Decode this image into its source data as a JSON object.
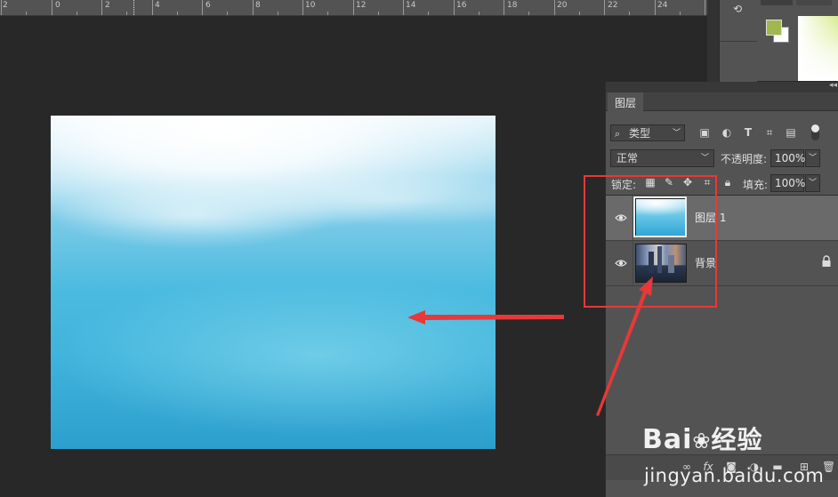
{
  "ruler": {
    "labels": [
      "2",
      "0",
      "2",
      "4",
      "6",
      "8",
      "10",
      "12",
      "14",
      "16",
      "18",
      "20",
      "22",
      "24"
    ]
  },
  "layers_panel": {
    "tab": "图层",
    "filter": {
      "selected": "类型"
    },
    "blend_mode": "正常",
    "opacity_label": "不透明度:",
    "opacity_value": "100%",
    "lock_label": "锁定:",
    "fill_label": "填充:",
    "fill_value": "100%",
    "layers": [
      {
        "name": "图层 1",
        "selected": true,
        "visible": true,
        "locked": false
      },
      {
        "name": "背景",
        "selected": false,
        "visible": true,
        "locked": true
      }
    ]
  },
  "colors": {
    "foreground": "#a0b84e",
    "background": "#ffffff",
    "annotation": "#e83838"
  },
  "watermark": {
    "logo": "Bai",
    "logo_cn": "经验",
    "url": "jingyan.baidu.com"
  }
}
